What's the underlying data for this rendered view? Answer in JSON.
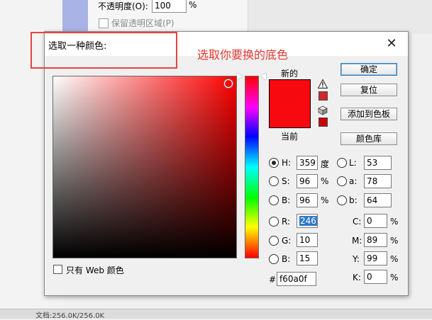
{
  "background": {
    "opacity_label": "不透明度(O):",
    "opacity_value": "100",
    "opacity_unit": "%",
    "preserve_transparency_label": "保留透明区域(P)",
    "status_text": "文档:256.0K/256.0K"
  },
  "dialog": {
    "title": "选取一种颜色:",
    "close_symbol": "✕"
  },
  "annotation": {
    "text": "选取你要换的底色",
    "color": "#e3362d"
  },
  "picker": {
    "hue_color": "#ff0000",
    "new_label": "新的",
    "current_label": "当前",
    "new_color": "#f60a0f",
    "current_color": "#f60a0f",
    "gamut_warning_icon": "warning-triangle-icon",
    "gamut_warning_color": "#d02a2a",
    "websafe_icon": "cube-icon",
    "websafe_color": "#cc0000"
  },
  "buttons": {
    "ok": "确定",
    "reset": "复位",
    "add_to_swatches": "添加到色板",
    "color_libraries": "颜色库"
  },
  "hsb": [
    {
      "label": "H:",
      "value": "359",
      "unit": "度",
      "selected": true
    },
    {
      "label": "S:",
      "value": "96",
      "unit": "%",
      "selected": false
    },
    {
      "label": "B:",
      "value": "96",
      "unit": "%",
      "selected": false
    }
  ],
  "lab": [
    {
      "label": "L:",
      "value": "53"
    },
    {
      "label": "a:",
      "value": "78"
    },
    {
      "label": "b:",
      "value": "64"
    }
  ],
  "rgb": [
    {
      "label": "R:",
      "value": "246"
    },
    {
      "label": "G:",
      "value": "10"
    },
    {
      "label": "B:",
      "value": "15"
    }
  ],
  "cmyk": [
    {
      "label": "C:",
      "value": "0",
      "unit": "%"
    },
    {
      "label": "M:",
      "value": "89",
      "unit": "%"
    },
    {
      "label": "Y:",
      "value": "99",
      "unit": "%"
    },
    {
      "label": "K:",
      "value": "0",
      "unit": "%"
    }
  ],
  "hex": {
    "prefix": "#",
    "value": "f60a0f"
  },
  "web_colors_only_label": "只有 Web 颜色"
}
